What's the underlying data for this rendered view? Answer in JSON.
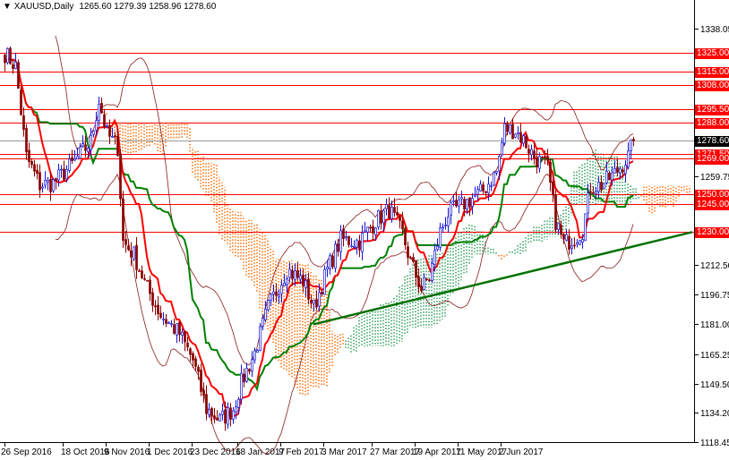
{
  "header": {
    "symbol": "XAUUSD,Daily",
    "ohlc": "1265.60 1279.39 1258.96 1278.60"
  },
  "colors": {
    "up": "#1414d8",
    "down": "#8b0000",
    "level": "#ff0000",
    "tenkan": "#ff0000",
    "kijun": "#008000",
    "bands": "#8b1a1a",
    "cloud_bear": "#ff6a00",
    "cloud_bull": "#2e9e5b",
    "trend": "#007000"
  },
  "chart_data": {
    "type": "candlestick",
    "title": "XAUUSD,Daily",
    "ylim": [
      1118.45,
      1338.05
    ],
    "y_ticks": [
      "1338.05",
      "1259.75",
      "1212.50",
      "1196.75",
      "1181.00",
      "1165.25",
      "1149.50",
      "1134.20",
      "1118.45"
    ],
    "x_labels": [
      {
        "bar": 0,
        "label": "26 Sep 2016"
      },
      {
        "bar": 16,
        "label": "18 Oct 2016"
      },
      {
        "bar": 32,
        "label": "9 Nov 2016"
      },
      {
        "bar": 48,
        "label": "1 Dec 2016"
      },
      {
        "bar": 64,
        "label": "23 Dec 2016"
      },
      {
        "bar": 81,
        "label": "18 Jan 2017"
      },
      {
        "bar": 97,
        "label": "9 Feb 2017"
      },
      {
        "bar": 113,
        "label": "3 Mar 2017"
      },
      {
        "bar": 131,
        "label": "27 Mar 2017"
      },
      {
        "bar": 147,
        "label": "19 Apr 2017"
      },
      {
        "bar": 163,
        "label": "11 May 2017"
      },
      {
        "bar": 179,
        "label": "2 Jun 2017"
      }
    ],
    "price_path_bar_close": [
      [
        0,
        1325
      ],
      [
        4,
        1318
      ],
      [
        8,
        1270
      ],
      [
        13,
        1255
      ],
      [
        18,
        1256
      ],
      [
        25,
        1266
      ],
      [
        32,
        1278
      ],
      [
        35,
        1300
      ],
      [
        38,
        1282
      ],
      [
        42,
        1275
      ],
      [
        44,
        1225
      ],
      [
        48,
        1218
      ],
      [
        53,
        1200
      ],
      [
        58,
        1186
      ],
      [
        65,
        1176
      ],
      [
        70,
        1162
      ],
      [
        75,
        1136
      ],
      [
        80,
        1130
      ],
      [
        85,
        1136
      ],
      [
        88,
        1150
      ],
      [
        93,
        1166
      ],
      [
        98,
        1190
      ],
      [
        105,
        1210
      ],
      [
        111,
        1204
      ],
      [
        115,
        1190
      ],
      [
        120,
        1210
      ],
      [
        125,
        1226
      ],
      [
        132,
        1225
      ],
      [
        138,
        1236
      ],
      [
        143,
        1242
      ],
      [
        148,
        1229
      ],
      [
        151,
        1214
      ],
      [
        155,
        1200
      ],
      [
        158,
        1206
      ],
      [
        162,
        1230
      ],
      [
        165,
        1240
      ],
      [
        172,
        1246
      ],
      [
        178,
        1252
      ],
      [
        183,
        1262
      ],
      [
        186,
        1285
      ],
      [
        190,
        1284
      ],
      [
        193,
        1279
      ],
      [
        197,
        1270
      ],
      [
        202,
        1264
      ],
      [
        205,
        1236
      ],
      [
        208,
        1224
      ],
      [
        212,
        1227
      ],
      [
        215,
        1231
      ],
      [
        218,
        1254
      ],
      [
        222,
        1255
      ],
      [
        227,
        1261
      ],
      [
        232,
        1270
      ],
      [
        234,
        1278.6
      ]
    ],
    "levels": [
      {
        "price": 1325.0,
        "label": "1325.00"
      },
      {
        "price": 1315.0,
        "label": "1315.00"
      },
      {
        "price": 1308.0,
        "label": "1308.00"
      },
      {
        "price": 1295.5,
        "label": "1295.50"
      },
      {
        "price": 1288.0,
        "label": "1288.00"
      },
      {
        "price": 1271.5,
        "label": "1271.50"
      },
      {
        "price": 1269.0,
        "label": "1269.00"
      },
      {
        "price": 1250.0,
        "label": "1250.00"
      },
      {
        "price": 1245.0,
        "label": "1245.00"
      },
      {
        "price": 1230.0,
        "label": "1230.00"
      }
    ],
    "current_price": {
      "price": 1278.6,
      "label": "1278.60"
    },
    "trendline": {
      "from": {
        "bar": 115,
        "price": 1181
      },
      "to": {
        "bar": 256,
        "price": 1230
      }
    },
    "indicators": [
      "Ichimoku (9,26,52)",
      "Bollinger Bands (20,2)"
    ]
  }
}
